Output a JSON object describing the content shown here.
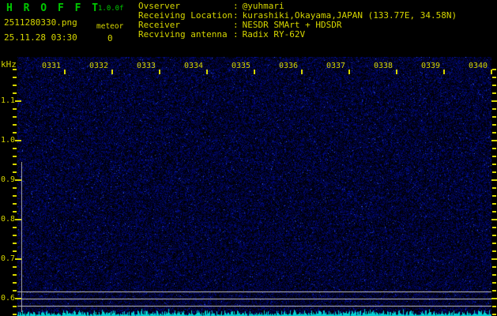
{
  "app": {
    "title": "H R O F F T",
    "version": "1.0.0f",
    "filename": "2511280330.png",
    "datetime": "25.11.28 03:30",
    "meteor_label": "meteor",
    "meteor_count": "0"
  },
  "info_separator": ":",
  "info_rows": [
    {
      "label": "Ovserver",
      "value": "@yuhmari"
    },
    {
      "label": "Receiving Location",
      "value": "kurashiki,Okayama,JAPAN (133.77E, 34.58N)"
    },
    {
      "label": "Receiver",
      "value": "NESDR SMArt + HDSDR"
    },
    {
      "label": "Recviving antenna",
      "value": "Radix RY-62V"
    }
  ],
  "chart_data": {
    "type": "heatmap",
    "subtype": "radio-meteor-echo-spectrogram",
    "title": "",
    "xlabel": "",
    "ylabel": "kHz",
    "x_tick_labels": [
      "0331",
      "0332",
      "0333",
      "0334",
      "0335",
      "0336",
      "0337",
      "0338",
      "0339",
      "0340"
    ],
    "y_tick_labels": [
      "1.1",
      "1.0",
      "0.9",
      "0.8",
      "0.7",
      "0.6"
    ],
    "y_tick_values_khz": [
      1.1,
      1.0,
      0.9,
      0.8,
      0.7,
      0.6
    ],
    "ylim_khz": [
      0.55,
      1.21
    ],
    "minor_tick_step_khz": 0.02,
    "time_span_minutes": 10,
    "marker_lines_khz": [
      0.618,
      0.6,
      0.582
    ],
    "meteor_echo_count": 0,
    "content_summary": "uniform dim blue RF background noise, no meteor echoes visible; jagged cyan noise-floor level trace along bottom edge; short gray vertical level-scale bar at left edge",
    "legend": "none",
    "grid": "off"
  },
  "colors": {
    "background": "#000000",
    "title_green": "#00c800",
    "label_yellow": "#d6d600",
    "noise_speckle_blue": "#2233cc",
    "marker_line_gray": "#b4b4b4",
    "level_scale_gray": "#9a9a9a",
    "noise_trace_cyan": "#00d2d2"
  }
}
